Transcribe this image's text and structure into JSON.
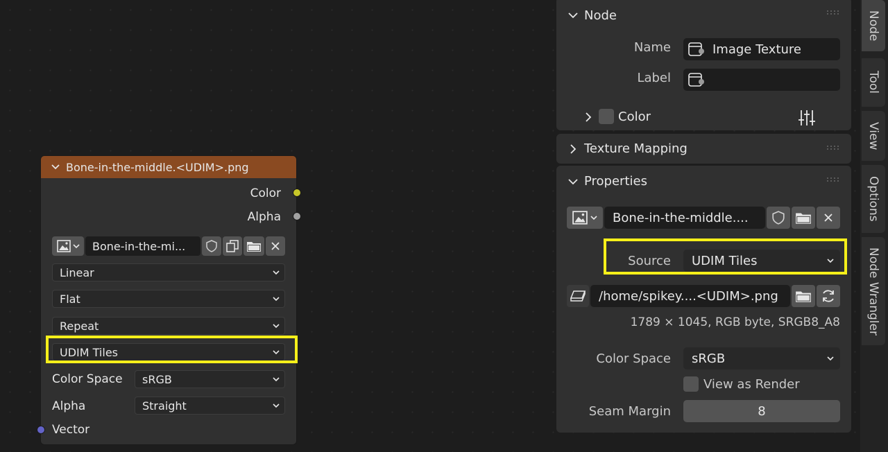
{
  "node": {
    "title": "Bone-in-the-middle.<UDIM>.png",
    "outputs": [
      "Color",
      "Alpha"
    ],
    "image_name": "Bone-in-the-mi...",
    "interpolation": "Linear",
    "projection": "Flat",
    "extension": "Repeat",
    "source": "UDIM Tiles",
    "color_space_label": "Color Space",
    "color_space": "sRGB",
    "alpha_label": "Alpha",
    "alpha": "Straight",
    "vector_label": "Vector",
    "colors": {
      "header": "#8a4a21",
      "color_socket": "#c7c729",
      "alpha_socket": "#a1a1a1",
      "vector_socket": "#6363c7"
    }
  },
  "sidebar": {
    "node_section": {
      "title": "Node",
      "name_label": "Name",
      "name_value": "Image Texture",
      "label_label": "Label",
      "label_value": "",
      "color_label": "Color"
    },
    "texture_mapping": {
      "title": "Texture Mapping"
    },
    "properties": {
      "title": "Properties",
      "image_name": "Bone-in-the-middle....",
      "source_label": "Source",
      "source_value": "UDIM Tiles",
      "filepath": "/home/spikey....<UDIM>.png",
      "image_info": "1789 × 1045,  RGB byte, SRGB8_A8",
      "color_space_label": "Color Space",
      "color_space_value": "sRGB",
      "view_as_render_label": "View as Render",
      "seam_margin_label": "Seam Margin",
      "seam_margin_value": "8"
    }
  },
  "tabs": [
    "Node",
    "Tool",
    "View",
    "Options",
    "Node Wrangler"
  ],
  "highlight_color": "#f5ef1a"
}
